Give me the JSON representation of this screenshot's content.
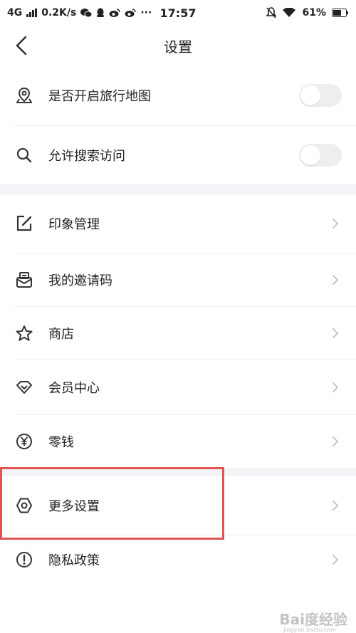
{
  "status_bar": {
    "network": "4G",
    "speed": "0.2K/s",
    "more": "···",
    "time": "17:57",
    "battery": "61%"
  },
  "header": {
    "title": "设置"
  },
  "section1": {
    "items": [
      {
        "label": "是否开启旅行地图",
        "icon": "map-pin-icon",
        "control": "toggle",
        "on": false
      },
      {
        "label": "允许搜索访问",
        "icon": "search-icon",
        "control": "toggle",
        "on": false
      }
    ]
  },
  "section2": {
    "items": [
      {
        "label": "印象管理",
        "icon": "edit-icon"
      },
      {
        "label": "我的邀请码",
        "icon": "envelope-icon"
      },
      {
        "label": "商店",
        "icon": "star-icon"
      },
      {
        "label": "会员中心",
        "icon": "diamond-icon"
      },
      {
        "label": "零钱",
        "icon": "yen-icon"
      }
    ]
  },
  "section3": {
    "items": [
      {
        "label": "更多设置",
        "icon": "hexagon-settings-icon",
        "highlighted": true
      },
      {
        "label": "隐私政策",
        "icon": "exclamation-icon"
      }
    ]
  },
  "colors": {
    "highlight": "#e05552",
    "section_gap": "#f4f3f7",
    "toggle_off": "#eeeef0",
    "chevron": "#c0c0c0"
  },
  "watermark": {
    "text": "Bai度经验",
    "sub": "jingyan.baidu.com"
  }
}
